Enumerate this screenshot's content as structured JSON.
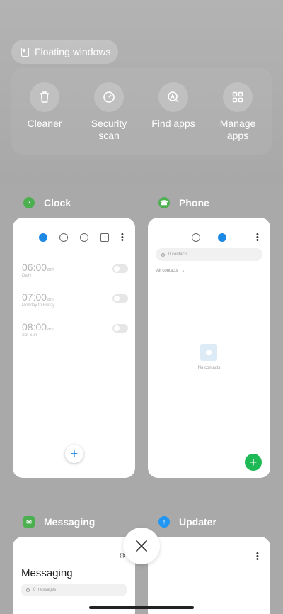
{
  "floating_windows": {
    "label": "Floating windows"
  },
  "quick_actions": [
    {
      "label": "Cleaner",
      "icon": "trash-icon"
    },
    {
      "label": "Security scan",
      "icon": "security-icon"
    },
    {
      "label": "Find apps",
      "icon": "find-apps-icon"
    },
    {
      "label": "Manage apps",
      "icon": "grid-icon"
    }
  ],
  "apps": {
    "clock": {
      "name": "Clock",
      "icon_color": "#4caf50",
      "alarms": [
        {
          "time": "06:00",
          "ampm": "am",
          "label": "Daily"
        },
        {
          "time": "07:00",
          "ampm": "am",
          "label": "Monday to Friday"
        },
        {
          "time": "08:00",
          "ampm": "am",
          "label": "Sat Sun"
        }
      ]
    },
    "phone": {
      "name": "Phone",
      "icon_color": "#4caf50",
      "search_placeholder": "0 contacts",
      "filter": "All contacts",
      "empty_text": "No contacts"
    },
    "messaging": {
      "name": "Messaging",
      "icon_color": "#4caf50",
      "title": "Messaging",
      "search_placeholder": "0 messages"
    },
    "updater": {
      "name": "Updater",
      "icon_color": "#2196f3"
    }
  },
  "colors": {
    "accent_blue": "#1e88e5",
    "green_fab": "#1db954"
  }
}
